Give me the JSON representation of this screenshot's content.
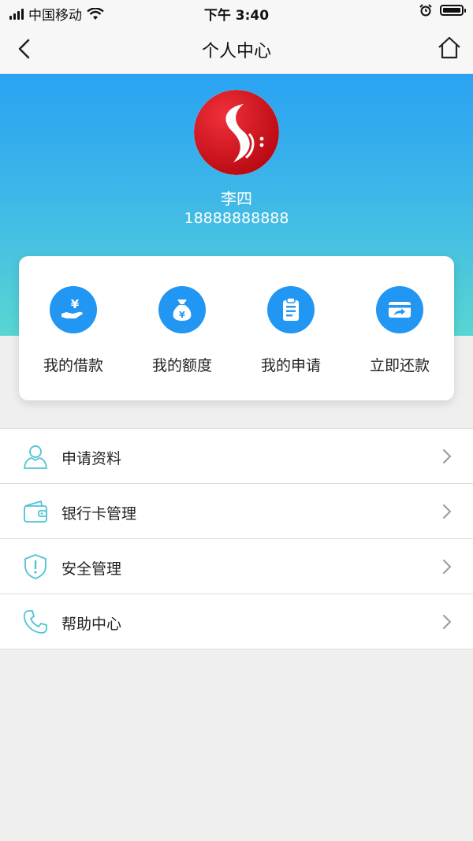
{
  "status_bar": {
    "carrier": "中国移动",
    "time": "下午 3:40",
    "icons": [
      "signal-icon",
      "wifi-icon",
      "alarm-icon",
      "battery-icon"
    ]
  },
  "navbar": {
    "title": "个人中心",
    "back_icon": "chevron-left-icon",
    "home_icon": "home-icon"
  },
  "profile": {
    "name": "李四",
    "phone": "18888888888",
    "avatar": "brand-logo"
  },
  "quick_actions": [
    {
      "label": "我的借款",
      "icon": "yen-hand-icon"
    },
    {
      "label": "我的额度",
      "icon": "money-bag-icon"
    },
    {
      "label": "我的申请",
      "icon": "clipboard-icon"
    },
    {
      "label": "立即还款",
      "icon": "card-repay-icon"
    }
  ],
  "menu": [
    {
      "label": "申请资料",
      "icon": "user-icon"
    },
    {
      "label": "银行卡管理",
      "icon": "wallet-icon"
    },
    {
      "label": "安全管理",
      "icon": "shield-icon"
    },
    {
      "label": "帮助中心",
      "icon": "phone-icon"
    }
  ],
  "colors": {
    "accent": "#2196f3",
    "gradient_top": "#2aa3f3",
    "gradient_bottom": "#58d6d3",
    "menu_icon": "#4fc3d8",
    "avatar_red": "#d8101c"
  }
}
